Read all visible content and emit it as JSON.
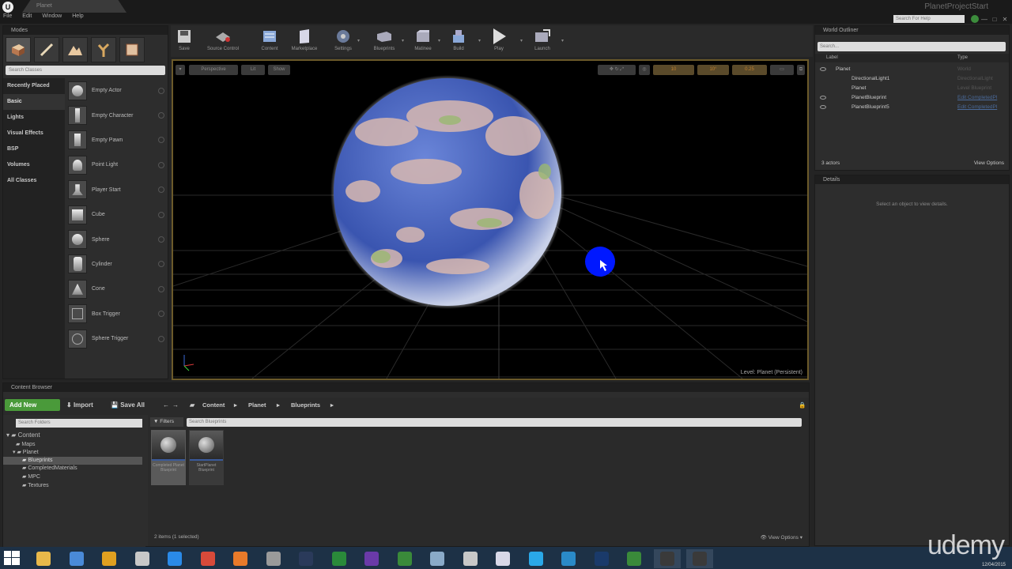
{
  "title_bar": {
    "logo": "U",
    "level_tab": "Planet",
    "project_title": "PlanetProjectStart",
    "search_help_placeholder": "Search For Help",
    "menu": [
      "File",
      "Edit",
      "Window",
      "Help"
    ],
    "window_buttons": [
      "—",
      "□",
      "✕"
    ]
  },
  "modes": {
    "tab": "Modes",
    "search_placeholder": "Search Classes",
    "categories": [
      "Recently Placed",
      "Basic",
      "Lights",
      "Visual Effects",
      "BSP",
      "Volumes",
      "All Classes"
    ],
    "selected_category": "Basic",
    "items": [
      "Empty Actor",
      "Empty Character",
      "Empty Pawn",
      "Point Light",
      "Player Start",
      "Cube",
      "Sphere",
      "Cylinder",
      "Cone",
      "Box Trigger",
      "Sphere Trigger"
    ]
  },
  "toolbar": {
    "buttons": [
      {
        "label": "Save",
        "icon": "save-icon"
      },
      {
        "label": "Source Control",
        "icon": "source-control-icon"
      },
      {
        "label": "Content",
        "icon": "content-icon"
      },
      {
        "label": "Marketplace",
        "icon": "marketplace-icon"
      },
      {
        "label": "Settings",
        "icon": "settings-icon"
      },
      {
        "label": "Blueprints",
        "icon": "blueprints-icon"
      },
      {
        "label": "Matinee",
        "icon": "matinee-icon"
      },
      {
        "label": "Build",
        "icon": "build-icon"
      },
      {
        "label": "Play",
        "icon": "play-icon"
      },
      {
        "label": "Launch",
        "icon": "launch-icon"
      }
    ]
  },
  "viewport": {
    "buttons_left": [
      "Perspective",
      "Lit",
      "Show"
    ],
    "buttons_right_values": [
      "10",
      "10°",
      "0.25"
    ],
    "level_label": "Level:  Planet (Persistent)",
    "highlight_color": "#6b5a2a",
    "ocean_color": "#3a55b0",
    "marker_color": "#0018ff"
  },
  "outliner": {
    "tab": "World Outliner",
    "search_placeholder": "Search...",
    "col_label": "Label",
    "col_type": "Type",
    "rows": [
      {
        "label": "Planet",
        "type": "World",
        "indent": 0,
        "link": false
      },
      {
        "label": "DirectionalLight1",
        "type": "DirectionalLight",
        "indent": 1,
        "link": false
      },
      {
        "label": "Planet",
        "type": "Level Blueprint",
        "indent": 1,
        "link": false
      },
      {
        "label": "PlanetBlueprint",
        "type": "Edit CompletedPl",
        "indent": 1,
        "link": true
      },
      {
        "label": "PlanetBlueprint5",
        "type": "Edit CompletedPl",
        "indent": 1,
        "link": true
      }
    ],
    "count": "3 actors",
    "view_options": "View Options"
  },
  "details": {
    "tab": "Details",
    "message": "Select an object to view details."
  },
  "content_browser": {
    "tab": "Content Browser",
    "add_new": "Add New",
    "import": "Import",
    "save_all": "Save All",
    "breadcrumbs": [
      "Content",
      "Planet",
      "Blueprints"
    ],
    "search_folders_placeholder": "Search Folders",
    "folders": [
      {
        "name": "Content",
        "level": 0,
        "selected": false
      },
      {
        "name": "Maps",
        "level": 1,
        "selected": false
      },
      {
        "name": "Planet",
        "level": 1,
        "selected": false
      },
      {
        "name": "Blueprints",
        "level": 2,
        "selected": true
      },
      {
        "name": "CompletedMaterials",
        "level": 2,
        "selected": false
      },
      {
        "name": "MPC",
        "level": 2,
        "selected": false
      },
      {
        "name": "Textures",
        "level": 2,
        "selected": false
      }
    ],
    "filters": "Filters",
    "search_assets_placeholder": "Search Blueprints",
    "assets": [
      "Completed Planet Blueprint",
      "StartPlanet Blueprint"
    ],
    "item_count": "2 items (1 selected)",
    "view_options": "View Options"
  },
  "taskbar": {
    "apps": [
      {
        "icon": "explorer-icon",
        "color": "#e8b84a"
      },
      {
        "icon": "monitor-icon",
        "color": "#4a8ad8"
      },
      {
        "icon": "chrome-canary-icon",
        "color": "#e0a020"
      },
      {
        "icon": "notes-icon",
        "color": "#c8c8c8"
      },
      {
        "icon": "ie-icon",
        "color": "#2a8ae8"
      },
      {
        "icon": "chrome-icon",
        "color": "#d84a3a"
      },
      {
        "icon": "firefox-icon",
        "color": "#e87a2a"
      },
      {
        "icon": "folder-icon",
        "color": "#9a9a9a"
      },
      {
        "icon": "steam-icon",
        "color": "#2a3a5a"
      },
      {
        "icon": "excel-icon",
        "color": "#2a8a3a"
      },
      {
        "icon": "visual-studio-icon",
        "color": "#6a3aa8"
      },
      {
        "icon": "sublime-icon",
        "color": "#3a8a3a"
      },
      {
        "icon": "notepad-icon",
        "color": "#8aaac8"
      },
      {
        "icon": "document-icon",
        "color": "#c8c8c8"
      },
      {
        "icon": "paint-icon",
        "color": "#d8d8e8"
      },
      {
        "icon": "skype-icon",
        "color": "#2aa8e8"
      },
      {
        "icon": "media-icon",
        "color": "#2a8ac8"
      },
      {
        "icon": "photoshop-icon",
        "color": "#1a3a6a"
      },
      {
        "icon": "app-icon",
        "color": "#3a8a3a"
      },
      {
        "icon": "epic-launcher-icon",
        "color": "#3a3a3a"
      },
      {
        "icon": "unreal-editor-icon",
        "color": "#3a3a3a"
      }
    ],
    "brand": "udemy",
    "date": "12/04/2015"
  }
}
